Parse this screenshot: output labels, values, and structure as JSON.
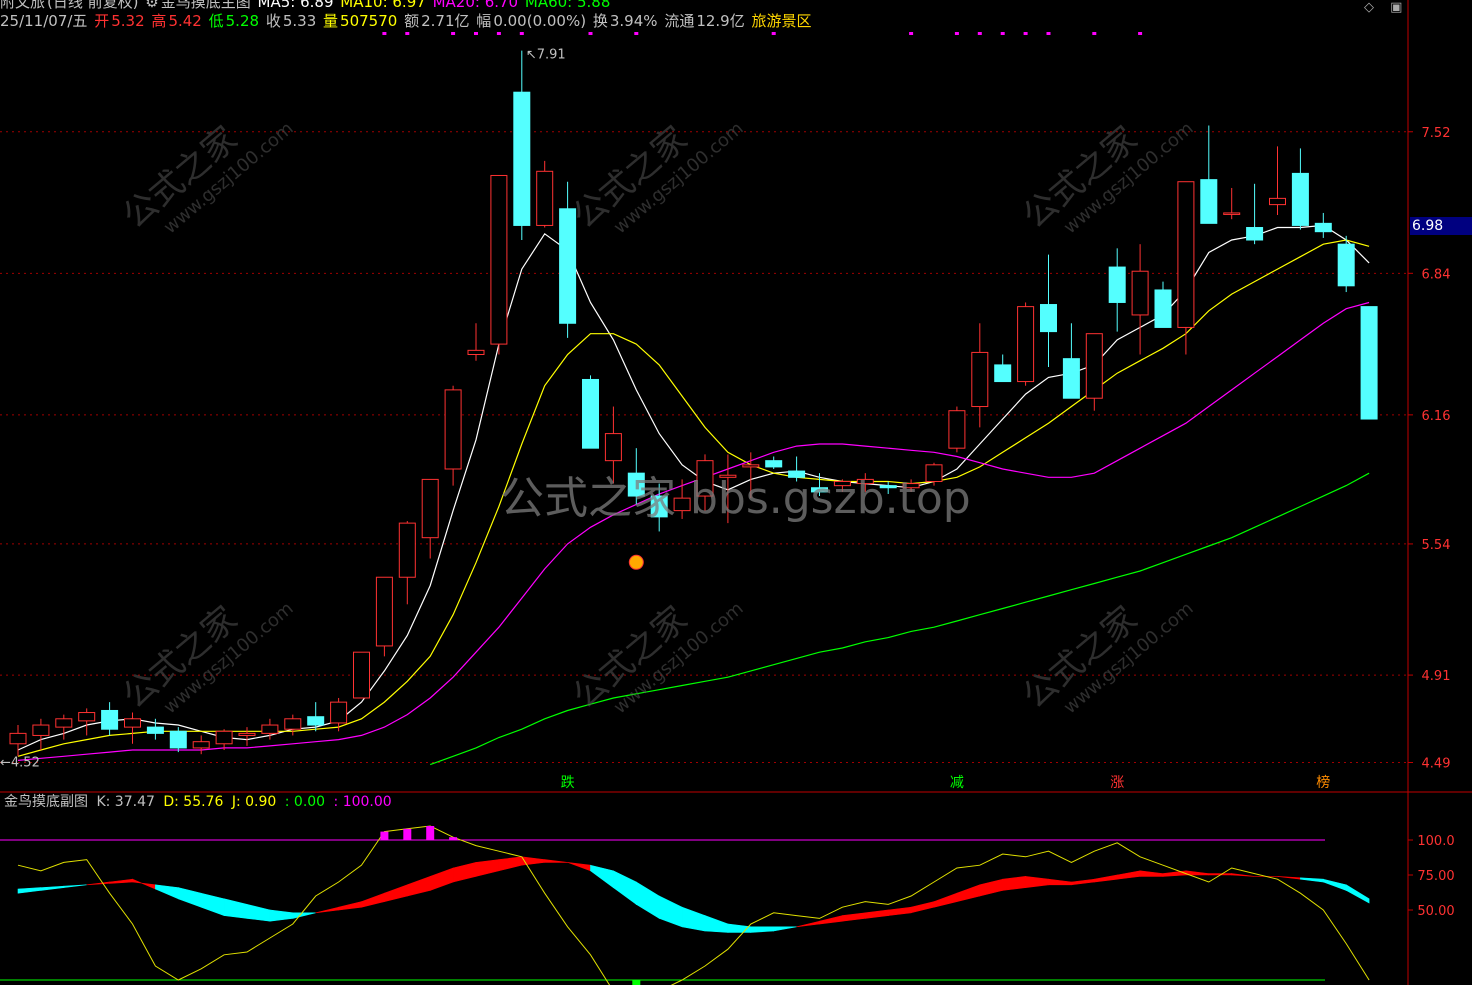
{
  "header": {
    "stock": "附文旅",
    "period": "(日线 前复权)",
    "indicator_name": "金鸟摸底主图",
    "ma5": "MA5: 6.89",
    "ma10": "MA10: 6.97",
    "ma20": "MA20: 6.70",
    "ma60": "MA60: 5.88",
    "date": "25/11/07/五",
    "open_label": "开",
    "open": "5.32",
    "high_label": "高",
    "high": "5.42",
    "low_label": "低",
    "low": "5.28",
    "close_label": "收",
    "close": "5.33",
    "vol_label": "量",
    "vol": "507570",
    "amount_label": "额",
    "amount": "2.71亿",
    "range_label": "幅",
    "range": "0.00(0.00%)",
    "turnover_label": "换",
    "turnover": "3.94%",
    "float_label": "流通",
    "float": "12.9亿",
    "sector": "旅游景区"
  },
  "sub_header": {
    "name": "金鸟摸底副图",
    "k": "K: 37.47",
    "d": "D: 55.76",
    "j": "J: 0.90",
    "v1": ": 0.00",
    "v2": ": 100.00"
  },
  "current_price": "6.98",
  "watermark": {
    "center": "公式之家 bbs.gszb.top",
    "diag_cn": "公式之家",
    "diag_url": "www.gszj100.com"
  },
  "colors": {
    "up": "#ff3232",
    "down": "#54ffff",
    "ma5": "#ffffff",
    "ma10": "#ffff00",
    "ma20": "#ff00ff",
    "ma60": "#00ff00",
    "grid": "#a00000",
    "k_area_up": "#ff0000",
    "k_area_down": "#00ffff",
    "j_line": "#e0e000"
  },
  "chart_data": [
    {
      "type": "candlestick",
      "title": "金鸟摸底主图",
      "y_ticks": [
        7.52,
        6.84,
        6.16,
        5.54,
        4.91,
        4.49
      ],
      "ylim": [
        4.43,
        7.98
      ],
      "high_annotation": "7.91",
      "low_annotation": "4.52",
      "candles": [
        [
          4.58,
          4.67,
          4.52,
          4.63
        ],
        [
          4.62,
          4.7,
          4.55,
          4.67
        ],
        [
          4.66,
          4.72,
          4.6,
          4.7
        ],
        [
          4.69,
          4.75,
          4.62,
          4.73
        ],
        [
          4.74,
          4.78,
          4.62,
          4.65
        ],
        [
          4.66,
          4.73,
          4.58,
          4.7
        ],
        [
          4.66,
          4.7,
          4.6,
          4.63
        ],
        [
          4.64,
          4.66,
          4.54,
          4.56
        ],
        [
          4.56,
          4.62,
          4.53,
          4.59
        ],
        [
          4.58,
          4.65,
          4.55,
          4.64
        ],
        [
          4.62,
          4.66,
          4.57,
          4.63
        ],
        [
          4.63,
          4.7,
          4.6,
          4.67
        ],
        [
          4.65,
          4.72,
          4.62,
          4.7
        ],
        [
          4.71,
          4.78,
          4.64,
          4.67
        ],
        [
          4.68,
          4.8,
          4.64,
          4.78
        ],
        [
          4.8,
          5.01,
          4.8,
          5.02
        ],
        [
          5.05,
          5.38,
          5.0,
          5.38
        ],
        [
          5.38,
          5.65,
          5.25,
          5.64
        ],
        [
          5.57,
          5.85,
          5.47,
          5.85
        ],
        [
          5.9,
          6.3,
          5.82,
          6.28
        ],
        [
          6.45,
          6.6,
          6.42,
          6.47
        ],
        [
          6.5,
          7.3,
          6.45,
          7.31
        ],
        [
          7.71,
          7.91,
          7.0,
          7.07
        ],
        [
          7.07,
          7.38,
          7.06,
          7.33
        ],
        [
          7.15,
          7.28,
          6.53,
          6.6
        ],
        [
          6.33,
          6.35,
          6.0,
          6.0
        ],
        [
          5.94,
          6.2,
          5.83,
          6.07
        ],
        [
          5.88,
          6.0,
          5.73,
          5.77
        ],
        [
          5.77,
          5.83,
          5.6,
          5.67
        ],
        [
          5.7,
          5.85,
          5.66,
          5.76
        ],
        [
          5.77,
          5.97,
          5.7,
          5.94
        ],
        [
          5.86,
          5.97,
          5.64,
          5.87
        ],
        [
          5.91,
          5.98,
          5.76,
          5.92
        ],
        [
          5.94,
          5.96,
          5.9,
          5.91
        ],
        [
          5.89,
          5.96,
          5.84,
          5.86
        ],
        [
          5.81,
          5.88,
          5.77,
          5.79
        ],
        [
          5.82,
          5.85,
          5.79,
          5.84
        ],
        [
          5.83,
          5.88,
          5.79,
          5.85
        ],
        [
          5.82,
          5.84,
          5.78,
          5.81
        ],
        [
          5.81,
          5.85,
          5.79,
          5.83
        ],
        [
          5.84,
          5.93,
          5.82,
          5.92
        ],
        [
          6.0,
          6.2,
          5.98,
          6.18
        ],
        [
          6.2,
          6.6,
          6.1,
          6.46
        ],
        [
          6.4,
          6.45,
          6.35,
          6.32
        ],
        [
          6.32,
          6.7,
          6.3,
          6.68
        ],
        [
          6.69,
          6.93,
          6.39,
          6.56
        ],
        [
          6.43,
          6.6,
          6.32,
          6.24
        ],
        [
          6.24,
          6.55,
          6.18,
          6.55
        ],
        [
          6.87,
          6.96,
          6.56,
          6.7
        ],
        [
          6.64,
          6.98,
          6.45,
          6.85
        ],
        [
          6.76,
          6.8,
          6.58,
          6.58
        ],
        [
          6.58,
          6.82,
          6.45,
          7.28
        ],
        [
          7.29,
          7.55,
          7.08,
          7.08
        ],
        [
          7.13,
          7.25,
          7.1,
          7.13
        ],
        [
          7.06,
          7.27,
          6.98,
          7.0
        ],
        [
          7.17,
          7.45,
          7.12,
          7.2
        ],
        [
          7.32,
          7.44,
          7.05,
          7.07
        ],
        [
          7.08,
          7.13,
          7.01,
          7.04
        ],
        [
          6.98,
          7.02,
          6.75,
          6.78
        ],
        [
          6.68,
          6.68,
          6.14,
          6.14
        ]
      ],
      "series": [
        {
          "name": "MA5",
          "values": [
            4.55,
            4.6,
            4.63,
            4.67,
            4.69,
            4.7,
            4.68,
            4.67,
            4.64,
            4.61,
            4.6,
            4.62,
            4.65,
            4.66,
            4.69,
            4.78,
            4.93,
            5.1,
            5.34,
            5.7,
            6.04,
            6.5,
            6.86,
            7.03,
            6.95,
            6.7,
            6.52,
            6.28,
            6.07,
            5.92,
            5.84,
            5.8,
            5.85,
            5.88,
            5.89,
            5.86,
            5.84,
            5.83,
            5.82,
            5.81,
            5.84,
            5.9,
            6.02,
            6.14,
            6.26,
            6.34,
            6.36,
            6.4,
            6.52,
            6.58,
            6.64,
            6.76,
            6.94,
            7.0,
            7.02,
            7.06,
            7.06,
            7.07,
            7.0,
            6.89
          ]
        },
        {
          "name": "MA10",
          "values": [
            4.52,
            4.55,
            4.58,
            4.6,
            4.62,
            4.63,
            4.64,
            4.64,
            4.64,
            4.64,
            4.64,
            4.64,
            4.64,
            4.65,
            4.66,
            4.7,
            4.78,
            4.88,
            5.0,
            5.2,
            5.45,
            5.72,
            6.02,
            6.3,
            6.45,
            6.55,
            6.55,
            6.5,
            6.4,
            6.25,
            6.1,
            5.98,
            5.92,
            5.88,
            5.86,
            5.85,
            5.84,
            5.84,
            5.84,
            5.83,
            5.84,
            5.86,
            5.91,
            5.98,
            6.05,
            6.12,
            6.2,
            6.28,
            6.36,
            6.42,
            6.48,
            6.55,
            6.66,
            6.74,
            6.8,
            6.86,
            6.92,
            6.98,
            7.0,
            6.97
          ]
        },
        {
          "name": "MA20",
          "values": [
            4.5,
            4.51,
            4.52,
            4.53,
            4.54,
            4.55,
            4.55,
            4.55,
            4.55,
            4.56,
            4.56,
            4.57,
            4.58,
            4.59,
            4.6,
            4.62,
            4.66,
            4.72,
            4.8,
            4.9,
            5.02,
            5.14,
            5.28,
            5.42,
            5.54,
            5.62,
            5.68,
            5.73,
            5.78,
            5.82,
            5.86,
            5.9,
            5.94,
            5.98,
            6.01,
            6.02,
            6.02,
            6.01,
            6.0,
            5.99,
            5.98,
            5.96,
            5.93,
            5.9,
            5.88,
            5.86,
            5.86,
            5.88,
            5.94,
            6.0,
            6.06,
            6.12,
            6.2,
            6.28,
            6.36,
            6.44,
            6.52,
            6.6,
            6.67,
            6.7
          ]
        },
        {
          "name": "MA60",
          "values": [
            null,
            null,
            null,
            null,
            null,
            null,
            null,
            null,
            null,
            null,
            null,
            null,
            null,
            null,
            null,
            null,
            null,
            null,
            4.48,
            4.52,
            4.56,
            4.61,
            4.65,
            4.7,
            4.74,
            4.77,
            4.8,
            4.82,
            4.84,
            4.86,
            4.88,
            4.9,
            4.93,
            4.96,
            4.99,
            5.02,
            5.04,
            5.07,
            5.09,
            5.12,
            5.14,
            5.17,
            5.2,
            5.23,
            5.26,
            5.29,
            5.32,
            5.35,
            5.38,
            5.41,
            5.45,
            5.49,
            5.53,
            5.57,
            5.62,
            5.67,
            5.72,
            5.77,
            5.82,
            5.88
          ]
        }
      ],
      "markers": [
        {
          "index": 24,
          "label": "跌",
          "color": "#00ff00"
        },
        {
          "index": 41,
          "label": "减",
          "color": "#00ff00"
        },
        {
          "index": 48,
          "label": "涨",
          "color": "#ff3232"
        },
        {
          "index": 57,
          "label": "榜",
          "color": "#ff8c00"
        }
      ]
    },
    {
      "type": "area",
      "title": "金鸟摸底副图",
      "y_ticks": [
        100.0,
        75.0,
        50.0
      ],
      "ylim": [
        0,
        120
      ],
      "series": [
        {
          "name": "K",
          "values": [
            62,
            64,
            66,
            68,
            70,
            72,
            65,
            58,
            52,
            46,
            44,
            42,
            44,
            48,
            52,
            56,
            62,
            68,
            74,
            80,
            84,
            86,
            88,
            86,
            84,
            78,
            66,
            54,
            44,
            38,
            35,
            34,
            34,
            35,
            38,
            42,
            46,
            48,
            50,
            52,
            56,
            62,
            68,
            72,
            74,
            72,
            70,
            72,
            75,
            78,
            76,
            78,
            76,
            76,
            74,
            74,
            72,
            70,
            64,
            55
          ]
        },
        {
          "name": "D",
          "values": [
            65,
            66,
            67,
            68,
            69,
            70,
            68,
            66,
            62,
            58,
            54,
            50,
            48,
            48,
            50,
            52,
            56,
            60,
            64,
            70,
            74,
            78,
            82,
            84,
            84,
            82,
            78,
            70,
            60,
            52,
            46,
            40,
            38,
            38,
            38,
            40,
            42,
            44,
            46,
            48,
            52,
            56,
            60,
            64,
            66,
            68,
            68,
            70,
            72,
            74,
            74,
            75,
            75,
            75,
            74,
            74,
            73,
            72,
            68,
            58
          ]
        },
        {
          "name": "J",
          "values": [
            82,
            78,
            84,
            86,
            62,
            40,
            10,
            0,
            8,
            18,
            20,
            30,
            40,
            60,
            70,
            82,
            106,
            108,
            110,
            102,
            96,
            92,
            88,
            62,
            38,
            18,
            -8,
            -12,
            -8,
            0,
            10,
            22,
            40,
            48,
            46,
            44,
            52,
            56,
            54,
            60,
            70,
            80,
            82,
            90,
            88,
            92,
            84,
            92,
            98,
            88,
            82,
            76,
            70,
            80,
            76,
            72,
            62,
            50,
            26,
            0
          ]
        }
      ],
      "lines": [
        100,
        0
      ]
    }
  ]
}
